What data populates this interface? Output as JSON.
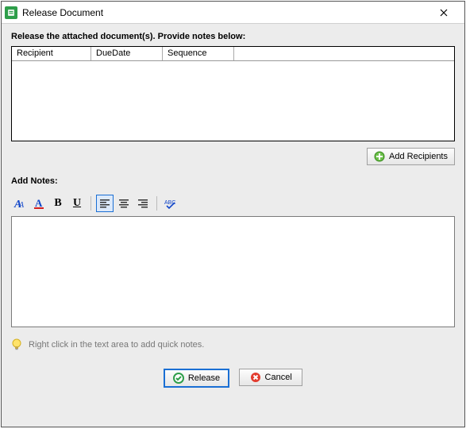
{
  "window": {
    "title": "Release Document"
  },
  "header": {
    "instruction": "Release the attached document(s). Provide notes below:"
  },
  "grid": {
    "columns": [
      "Recipient",
      "DueDate",
      "Sequence"
    ]
  },
  "buttons": {
    "add_recipients": "Add Recipients",
    "release": "Release",
    "cancel": "Cancel"
  },
  "notes": {
    "label": "Add Notes:",
    "hint": "Right click in the text area to add quick notes."
  },
  "toolbar": {
    "bold": "B",
    "underline": "U"
  }
}
